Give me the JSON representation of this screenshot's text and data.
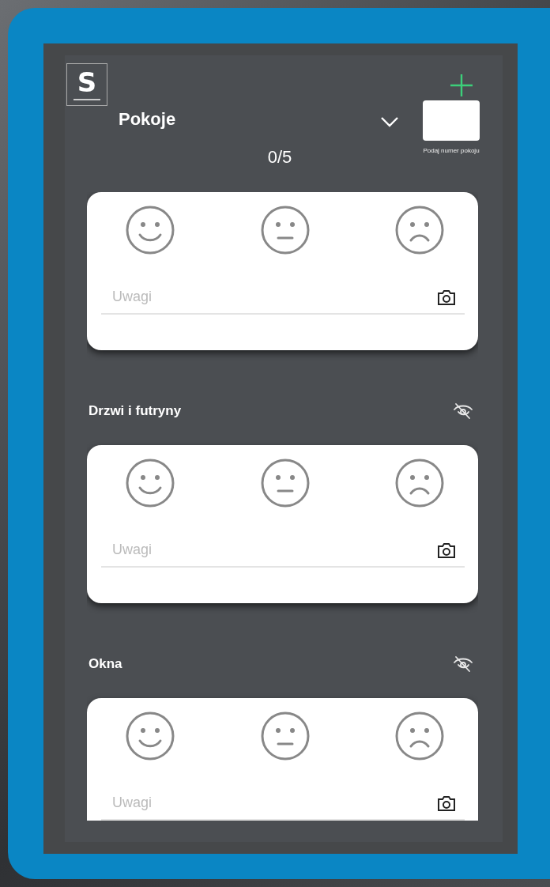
{
  "logo": {
    "mark": "S"
  },
  "header": {
    "title": "Pokoje",
    "room_number": {
      "caption": "Podaj numer pokoju"
    },
    "progress": "0/5"
  },
  "sections": [
    {
      "placeholder": "Uwagi"
    },
    {
      "title": "Drzwi i futryny",
      "placeholder": "Uwagi"
    },
    {
      "title": "Okna",
      "placeholder": "Uwagi"
    }
  ]
}
